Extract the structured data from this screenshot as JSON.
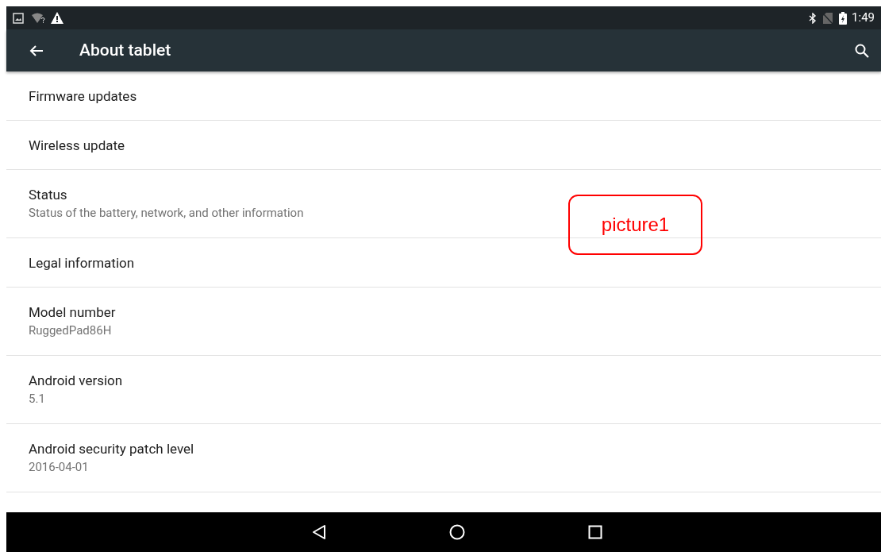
{
  "status_bar": {
    "time": "1:49"
  },
  "app_bar": {
    "title": "About tablet"
  },
  "items": [
    {
      "title": "Firmware updates"
    },
    {
      "title": "Wireless update"
    },
    {
      "title": "Status",
      "summary": "Status of the battery, network, and other information"
    },
    {
      "title": "Legal information"
    },
    {
      "title": "Model number",
      "summary": "RuggedPad86H"
    },
    {
      "title": "Android version",
      "summary": "5.1"
    },
    {
      "title": "Android security patch level",
      "summary": "2016-04-01"
    }
  ],
  "callout": {
    "label": "picture1"
  }
}
